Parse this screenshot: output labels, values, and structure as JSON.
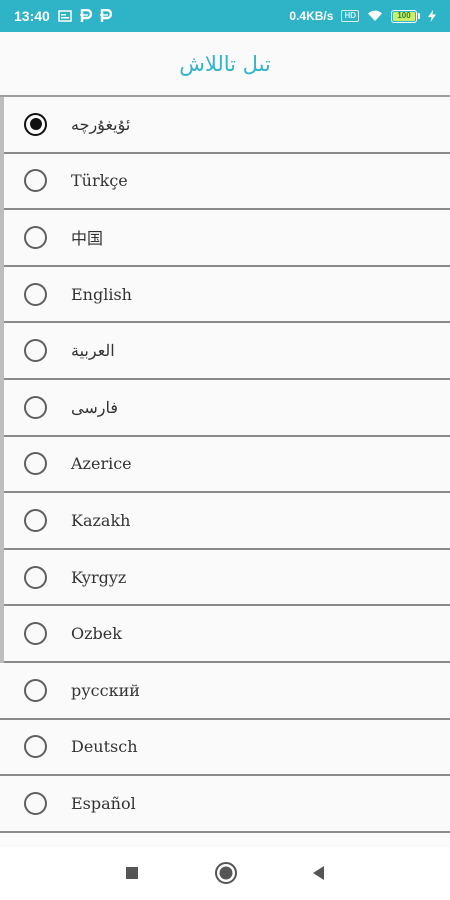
{
  "status_bar": {
    "time": "13:40",
    "left_icons": [
      "gallery-icon",
      "p-icon",
      "p-icon"
    ],
    "net_speed": "0.4KB/s",
    "hd_label": "HD",
    "battery_level": "100",
    "battery_fraction": 1.0,
    "background": "#2fb3c6"
  },
  "header": {
    "title": "تىل تاللاش",
    "color": "#33b5c9"
  },
  "languages": [
    {
      "label": "ئۇيغۇرچە",
      "selected": true
    },
    {
      "label": "Türkçe",
      "selected": false
    },
    {
      "label": "中国",
      "selected": false
    },
    {
      "label": "English",
      "selected": false
    },
    {
      "label": "العربية",
      "selected": false
    },
    {
      "label": "فارسی",
      "selected": false
    },
    {
      "label": "Azerice",
      "selected": false
    },
    {
      "label": "Kazakh",
      "selected": false
    },
    {
      "label": "Kyrgyz",
      "selected": false
    },
    {
      "label": "Ozbek",
      "selected": false
    },
    {
      "label": "русский",
      "selected": false
    },
    {
      "label": "Deutsch",
      "selected": false
    },
    {
      "label": "Español",
      "selected": false
    }
  ],
  "nav_bar": {
    "icons": [
      "recents-icon",
      "home-icon",
      "back-icon"
    ]
  }
}
